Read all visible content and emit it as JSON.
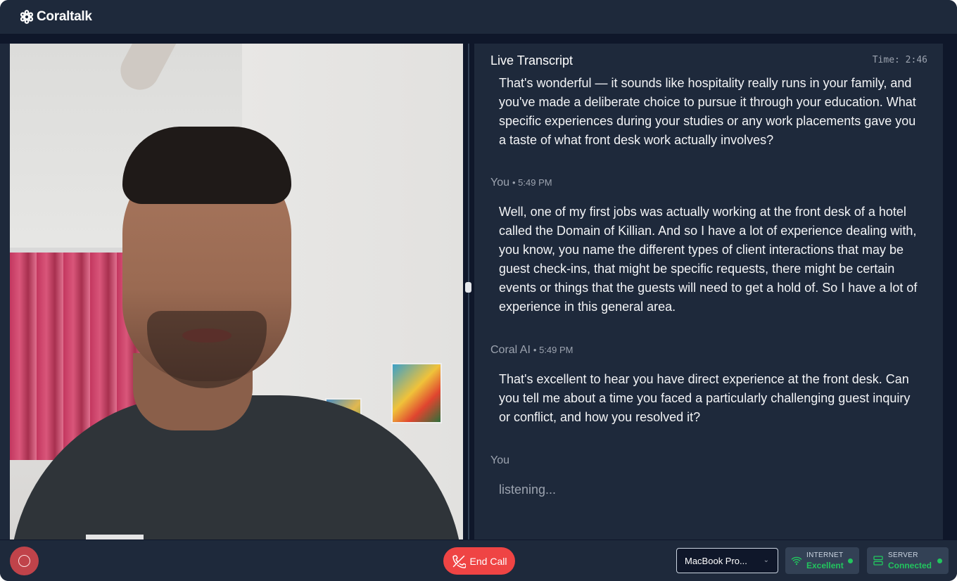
{
  "app": {
    "name": "Coraltalk"
  },
  "transcript": {
    "title": "Live Transcript",
    "timer": "Time: 2:46",
    "messages": [
      {
        "speaker": "",
        "time": "",
        "text": "That's wonderful — it sounds like hospitality really runs in your family, and you've made a deliberate choice to pursue it through your education. What specific experiences during your studies or any work placements gave you a taste of what front desk work actually involves?"
      },
      {
        "speaker": "You",
        "time": "• 5:49 PM",
        "text": "Well, one of my first jobs was actually working at the front desk of a hotel called the Domain of Killian. And so I have a lot of experience dealing with, you know, you name the different types of client interactions that may be guest check-ins, that might be specific requests, there might be certain events or things that the guests will need to get a hold of. So I have a lot of experience in this general area."
      },
      {
        "speaker": "Coral AI",
        "time": "• 5:49 PM",
        "text": "That's excellent to hear you have direct experience at the front desk. Can you tell me about a time you faced a particularly challenging guest inquiry or conflict, and how you resolved it?"
      },
      {
        "speaker": "You",
        "time": "",
        "text": "listening..."
      }
    ]
  },
  "footer": {
    "end_call_label": "End Call",
    "device": "MacBook Pro...",
    "internet": {
      "label": "INTERNET",
      "value": "Excellent"
    },
    "server": {
      "label": "SERVER",
      "value": "Connected"
    }
  },
  "colors": {
    "accent_red": "#ef4444",
    "status_green": "#22c55e",
    "panel": "#1e293b",
    "background": "#0f172a"
  }
}
